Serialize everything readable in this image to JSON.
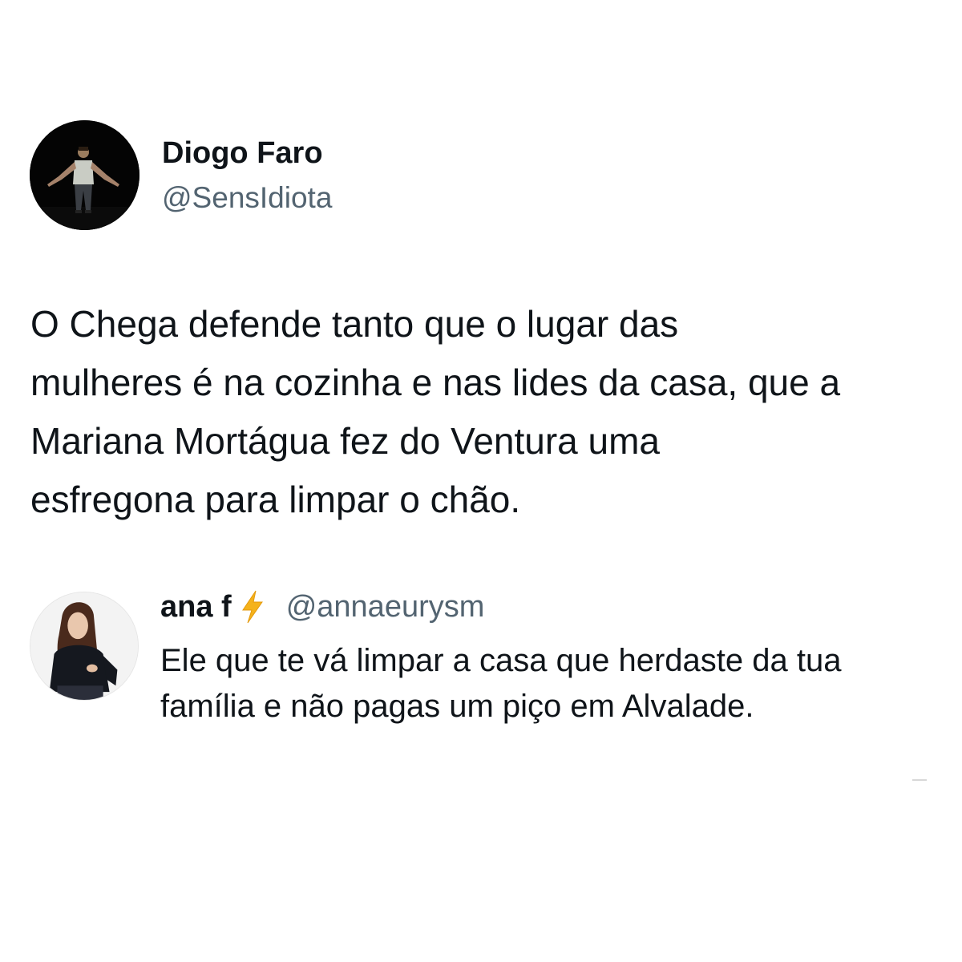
{
  "tweet": {
    "author_name": "Diogo Faro",
    "author_handle": "@SensIdiota",
    "text_lines": [
      "O Chega defende tanto que o lugar das",
      "mulheres é na cozinha e nas lides da casa, que a",
      "Mariana Mortágua fez do Ventura uma",
      "esfregona para limpar o chão."
    ]
  },
  "reply": {
    "author_name": "ana f",
    "author_handle": "@annaeurysm",
    "name_icon": "lightning-bolt-icon",
    "text_lines": [
      "Ele que te vá limpar a casa que herdaste da tua",
      "família e não pagas um piço em Alvalade."
    ]
  },
  "colors": {
    "text": "#0f1419",
    "secondary_text": "#536471",
    "bolt": "#f5b21b",
    "background": "#ffffff"
  }
}
